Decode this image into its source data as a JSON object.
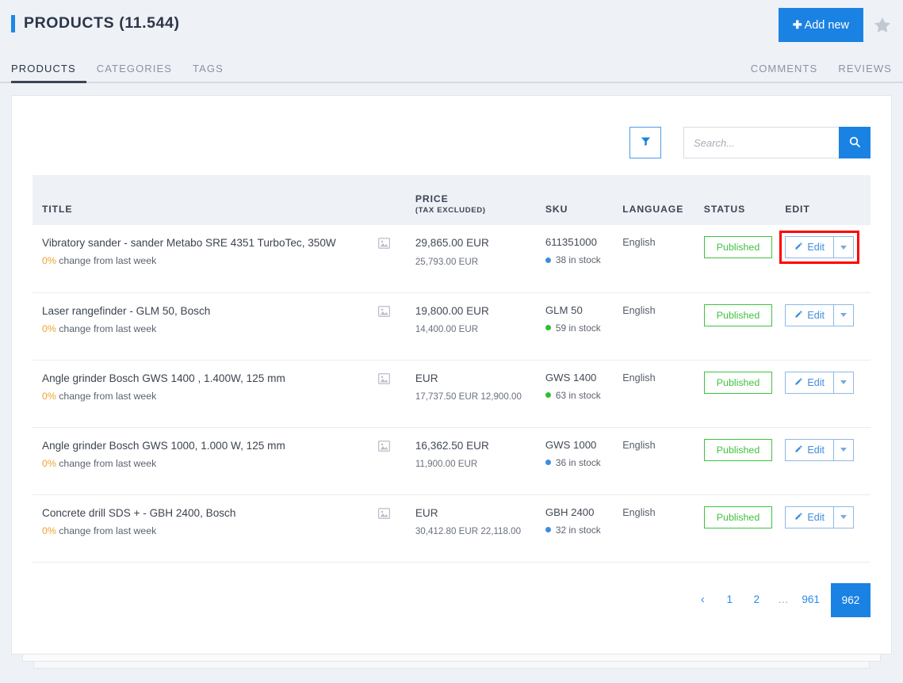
{
  "header": {
    "title": "PRODUCTS (11.544)",
    "add_new_label": "Add new",
    "plus": "✚",
    "favorite_icon": "star-icon"
  },
  "tabs": {
    "left": [
      {
        "label": "PRODUCTS",
        "active": true
      },
      {
        "label": "CATEGORIES",
        "active": false
      },
      {
        "label": "TAGS",
        "active": false
      }
    ],
    "right": [
      {
        "label": "COMMENTS"
      },
      {
        "label": "REVIEWS"
      }
    ]
  },
  "toolbar": {
    "filter_icon": "funnel-icon",
    "search_placeholder": "Search...",
    "search_value": "",
    "search_icon": "magnifier-icon"
  },
  "table": {
    "columns": {
      "title": "TITLE",
      "price": "PRICE",
      "price_sub": "(TAX EXCLUDED)",
      "sku": "SKU",
      "language": "LANGUAGE",
      "status": "STATUS",
      "edit": "EDIT"
    },
    "rows": [
      {
        "title": "Vibratory sander - sander Metabo SRE 4351 TurboTec, 350W",
        "change_pct": "0%",
        "change_text": "change from last week",
        "price_main": "29,865.00 EUR",
        "price_sub": "25,793.00 EUR",
        "sku": "611351000",
        "stock": "38 in stock",
        "stock_color": "#3b8ede",
        "language": "English",
        "status": "Published",
        "edit_label": "Edit",
        "highlighted": true
      },
      {
        "title": "Laser rangefinder - GLM 50, Bosch",
        "change_pct": "0%",
        "change_text": "change from last week",
        "price_main": "19,800.00 EUR",
        "price_sub": "14,400.00 EUR",
        "sku": "GLM 50",
        "stock": "59 in stock",
        "stock_color": "#2fbf2f",
        "language": "English",
        "status": "Published",
        "edit_label": "Edit",
        "highlighted": false
      },
      {
        "title": "Angle grinder Bosch GWS 1400 , 1.400W, 125 mm",
        "change_pct": "0%",
        "change_text": "change from last week",
        "price_main": "EUR",
        "price_sub": "17,737.50 EUR 12,900.00",
        "sku": "GWS 1400",
        "stock": "63 in stock",
        "stock_color": "#2fbf2f",
        "language": "English",
        "status": "Published",
        "edit_label": "Edit",
        "highlighted": false
      },
      {
        "title": "Angle grinder Bosch GWS 1000, 1.000 W, 125 mm",
        "change_pct": "0%",
        "change_text": "change from last week",
        "price_main": "16,362.50 EUR",
        "price_sub": "11,900.00 EUR",
        "sku": "GWS 1000",
        "stock": "36 in stock",
        "stock_color": "#3b8ede",
        "language": "English",
        "status": "Published",
        "edit_label": "Edit",
        "highlighted": false
      },
      {
        "title": "Concrete drill SDS + - GBH 2400, Bosch",
        "change_pct": "0%",
        "change_text": "change from last week",
        "price_main": "EUR",
        "price_sub": "30,412.80 EUR 22,118.00",
        "sku": "GBH 2400",
        "stock": "32 in stock",
        "stock_color": "#3b8ede",
        "language": "English",
        "status": "Published",
        "edit_label": "Edit",
        "highlighted": false
      }
    ]
  },
  "pagination": {
    "prev": "‹",
    "pages": [
      "1",
      "2",
      "…",
      "961"
    ],
    "active_page": "962"
  },
  "colors": {
    "accent": "#1a82e2",
    "published": "#3fc23f",
    "warning": "#f0a32e",
    "highlight": "#fe0000"
  }
}
